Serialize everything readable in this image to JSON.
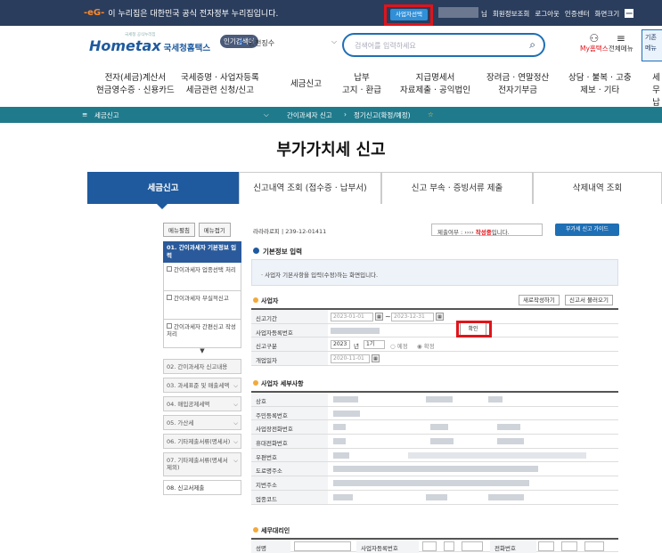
{
  "topbar": {
    "gov_emblem": "-eG-",
    "gov_notice": "이 누리집은 대한민국 공식 전자정부 누리집입니다.",
    "cert_button": "사업자선택",
    "user_suffix": "님",
    "links": [
      "회원정보조회",
      "로그아웃",
      "인증센터",
      "화면크기"
    ],
    "zoom_icon": "—"
  },
  "header": {
    "logo_main": "Hometax",
    "logo_sub": "국세청홈택스",
    "logo_tag": "국세청 공식누리집",
    "popular_label": "인기검색어",
    "popular_num": "5.",
    "popular_item": "원천징수",
    "search_placeholder": "검색어를 입력하세요",
    "my_label": "My홈택스",
    "allmenu_label": "전체메뉴",
    "right_tab": "기존 메뉴"
  },
  "gnb": [
    {
      "l1": "전자(세금)계산서",
      "l2": "현금영수증 · 신용카드"
    },
    {
      "l1": "국세증명 · 사업자등록",
      "l2": "세금관련 신청/신고"
    },
    {
      "l1": "세금신고",
      "l2": ""
    },
    {
      "l1": "납부",
      "l2": "고지 · 환급"
    },
    {
      "l1": "지급명세서",
      "l2": "자료제출 · 공익법인"
    },
    {
      "l1": "장려금 · 연말정산",
      "l2": "전자기부금"
    },
    {
      "l1": "상담 · 불복 · 고충",
      "l2": "제보 · 기타"
    },
    {
      "l1": "세무",
      "l2": "납세"
    }
  ],
  "navbar": {
    "menu_icon": "≡",
    "crumb1": "세금신고",
    "crumb2": "간이과세자 신고",
    "crumb3": "정기신고(확정/예정)"
  },
  "page_title": "부가가치세 신고",
  "tabs": [
    "세금신고",
    "신고내역 조회 (접수증 · 납부서)",
    "신고 부속 · 증빙서류 제출",
    "삭제내역 조회"
  ],
  "sidebar": {
    "open_btn": "메뉴펼침",
    "close_btn": "메뉴접기",
    "active": "01. 간이과세자 기본정보 입력",
    "subs": [
      "간이과세자 업종선택 처리",
      "간이과세자 부실적신고",
      "간이과세자 간편신고 작성 처리"
    ],
    "down_icon": "▼",
    "items": [
      "02. 간이과세자 신고내용",
      "03. 과세표준 및 매출세액",
      "04. 매입공제세액",
      "05. 가산세",
      "06. 기타제출서류(명세서)",
      "07. 기타제출서류(명세서 제외)",
      "08. 신고서제출"
    ]
  },
  "content": {
    "reg_no": "239-12-01411",
    "reg_prefix": "라라라로피",
    "status_prefix": "제출여부 :",
    "status_dots": "››››",
    "status_value": "작성중",
    "status_suffix": "입니다.",
    "guide_btn": "부가세 신고 가이드",
    "section_basic": "기본정보 입력",
    "notice": "· 사업자 기본사항을 입력(수정)하는 화면입니다.",
    "section_biz": "사업자",
    "btn_new": "새로작성하기",
    "btn_load": "신고서 불러오기",
    "period_label": "신고기간",
    "period_from": "2023-01-01",
    "period_to": "2023-12-31",
    "bizno_label": "사업자등록번호",
    "confirm_btn": "확인",
    "type_label": "신고구분",
    "year": "2023",
    "year_unit": "년",
    "term": "1기",
    "opt1": "예정",
    "opt2": "확정",
    "open_label": "개업일자",
    "open_date": "2020-11-01",
    "section_detail": "사업자 세부사항",
    "detail_labels": [
      "상호",
      "주민등록번호",
      "사업장전화번호",
      "휴대전화번호",
      "우편번호",
      "도로명주소",
      "지번주소",
      "업종코드"
    ],
    "section_agent": "세무대리인",
    "agent_name": "성명",
    "agent_bizno": "사업자등록번호",
    "agent_phone": "전화번호"
  }
}
